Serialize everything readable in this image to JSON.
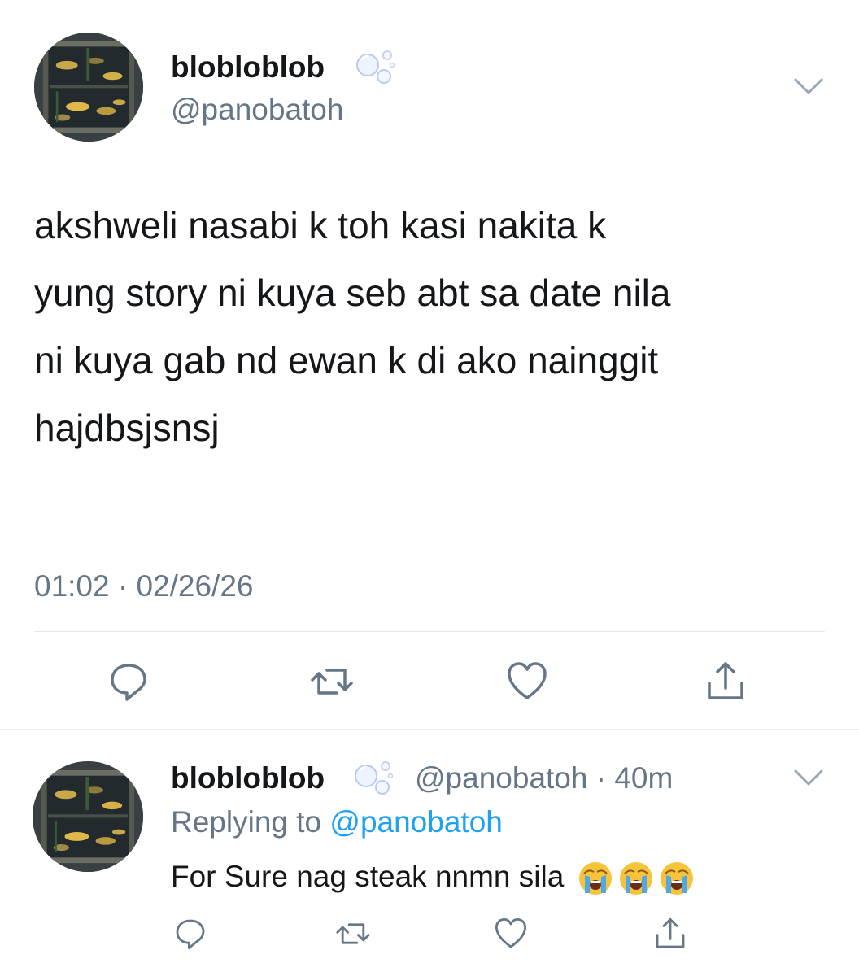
{
  "main_tweet": {
    "display_name": "blobloblob",
    "handle": "@panobatoh",
    "text_lines": [
      "akshweli nasabi k toh kasi nakita k",
      "yung story ni kuya seb abt sa date nila",
      "ni kuya gab nd ewan k di ako nainggit",
      "hajdbsjsnsj"
    ],
    "timestamp": "01:02 · 02/26/26",
    "actions": [
      "reply-icon",
      "retweet-icon",
      "like-icon",
      "share-icon"
    ]
  },
  "reply_tweet": {
    "display_name": "blobloblob",
    "handle": "@panobatoh",
    "time": "40m",
    "replying_prefix": "Replying to",
    "replying_to": "@panobatoh",
    "text": "For Sure nag steak nnmn sila",
    "emojis": [
      "loudly-crying-face-icon",
      "loudly-crying-face-icon",
      "loudly-crying-face-icon"
    ],
    "actions": [
      "reply-icon",
      "retweet-icon",
      "like-icon",
      "share-icon"
    ]
  },
  "colors": {
    "text": "#14171a",
    "secondary": "#657786",
    "link": "#1da1f2",
    "divider": "#e1e8ed"
  }
}
